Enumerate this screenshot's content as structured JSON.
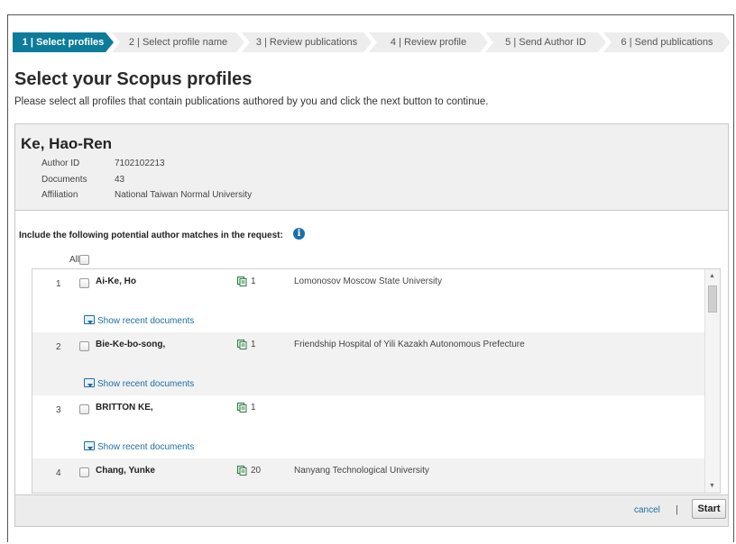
{
  "steps": [
    {
      "label": "1 | Select profiles"
    },
    {
      "label": "2 | Select profile name"
    },
    {
      "label": "3 | Review publications"
    },
    {
      "label": "4 | Review profile"
    },
    {
      "label": "5 | Send Author ID"
    },
    {
      "label": "6 | Send publications"
    }
  ],
  "page": {
    "title": "Select your Scopus profiles",
    "instructions": "Please select all profiles that contain publications authored by you and click the next button to continue."
  },
  "author": {
    "name": "Ke, Hao-Ren",
    "fields": [
      {
        "label": "Author ID",
        "value": "7102102213"
      },
      {
        "label": "Documents",
        "value": "43"
      },
      {
        "label": "Affiliation",
        "value": "National Taiwan Normal University"
      }
    ]
  },
  "matches": {
    "include_label": "Include the following potential author matches in the request:",
    "info_icon": "info-icon",
    "all_label": "All",
    "recent_label": "Show recent documents",
    "rows": [
      {
        "num": "1",
        "name": "Ai-Ke, Ho",
        "docs": "1",
        "affiliation": "Lomonosov Moscow State University"
      },
      {
        "num": "2",
        "name": "Bie-Ke-bo-song,",
        "docs": "1",
        "affiliation": "Friendship Hospital of Yili Kazakh Autonomous Prefecture"
      },
      {
        "num": "3",
        "name": "BRITTON KE,",
        "docs": "1",
        "affiliation": ""
      },
      {
        "num": "4",
        "name": "Chang, Yunke",
        "docs": "20",
        "affiliation": "Nanyang Technological University"
      }
    ]
  },
  "footer": {
    "cancel": "cancel",
    "separator": "|",
    "start": "Start"
  },
  "colors": {
    "active_step": "#0d7c9a",
    "link": "#1d6fa5"
  }
}
